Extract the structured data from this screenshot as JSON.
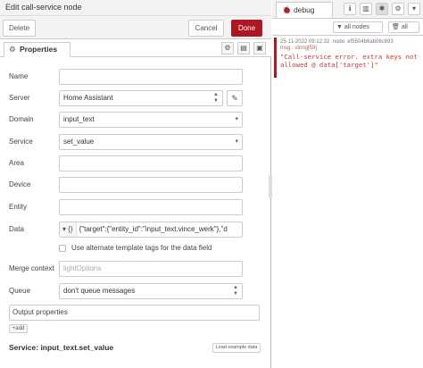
{
  "tray": {
    "title": "Edit call-service node",
    "delete_label": "Delete",
    "cancel_label": "Cancel",
    "done_label": "Done",
    "tab_properties": "Properties"
  },
  "form": {
    "name_label": "Name",
    "name_value": "",
    "server_label": "Server",
    "server_value": "Home Assistant",
    "domain_label": "Domain",
    "domain_value": "input_text",
    "service_label": "Service",
    "service_value": "set_value",
    "area_label": "Area",
    "area_value": "",
    "device_label": "Device",
    "device_value": "",
    "entity_label": "Entity",
    "entity_value": "",
    "data_label": "Data",
    "data_type": "{}",
    "data_value": "{\"target\":{\"entity_id\":\"input_text.vince_werk\"},\"d",
    "alt_template_label": "Use alternate template tags for the data field",
    "merge_label": "Merge context",
    "merge_placeholder": "lightOptions",
    "queue_label": "Queue",
    "queue_value": "don't queue messages",
    "output_properties_label": "Output properties",
    "add_label": "+add",
    "service_summary": "Service: input_text.set_value",
    "load_example_label": "Load example data"
  },
  "sidebar": {
    "tab_label": "debug",
    "filter_nodes_label": "all nodes",
    "clear_label": "all"
  },
  "debug_message": {
    "timestamp": "25-11-2022 09:12:32",
    "node": "node: ef5504b6ab06c893",
    "topic": "msg : string[59]",
    "body": "\"Call-service error. extra keys not allowed @ data['target']\""
  },
  "colors": {
    "accent": "#ad1625",
    "error_text": "#c0392b"
  },
  "icons": {
    "properties": "cog-icon",
    "edit": "pencil-icon",
    "info": "info-icon",
    "book": "book-icon",
    "debug": "bug-icon",
    "settings": "gear-icon",
    "dropdown": "chevron-down-icon"
  }
}
